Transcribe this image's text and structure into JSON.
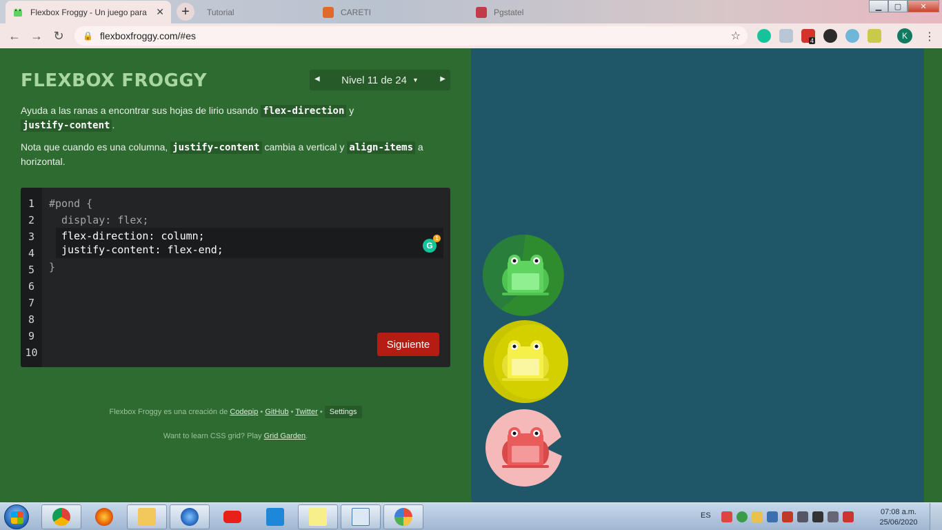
{
  "browser": {
    "tabs": [
      {
        "title": "Flexbox Froggy - Un juego para a",
        "active": true
      },
      {
        "title": "Tutorial",
        "active": false
      },
      {
        "title": "CARETI",
        "active": false
      },
      {
        "title": "Pgstatel",
        "active": false
      }
    ],
    "url": "flexboxfroggy.com/#es",
    "badge_count": "4",
    "profile_initial": "K"
  },
  "header": {
    "logo": "FLEXBOX FROGGY",
    "level_label": "Nivel 11 de 24",
    "prev_icon": "◀",
    "next_icon": "▶",
    "caret_icon": "▼"
  },
  "instructions": {
    "p1_before": "Ayuda a las ranas a encontrar sus hojas de lirio usando ",
    "p1_code1": "flex-direction",
    "p1_between": " y",
    "p1_code2": "justify-content",
    "p1_after": ".",
    "p2_before": "Nota que cuando es una columna, ",
    "p2_code1": "justify-content",
    "p2_between": " cambia a vertical y ",
    "p2_code2": "align-items",
    "p2_after": " a",
    "p2_line2": "horizontal."
  },
  "editor": {
    "line_numbers": [
      "1",
      "2",
      "3",
      "4",
      "5",
      "6",
      "7",
      "8",
      "9",
      "10"
    ],
    "line1": "#pond {",
    "line2": "  display: flex;",
    "input_line1": "flex-direction: column;",
    "input_line2": "justify-content: flex-end;",
    "line5": "}",
    "grammarly_letter": "G",
    "grammarly_count": "1",
    "next_label": "Siguiente"
  },
  "footer": {
    "credit_prefix": "Flexbox Froggy es una creación de",
    "link_codepip": "Codepip",
    "link_github": "GitHub",
    "link_twitter": "Twitter",
    "separator": "•",
    "settings_label": "Settings",
    "grid_prefix": "Want to learn CSS grid? Play",
    "link_grid_garden": "Grid Garden",
    "grid_suffix": "."
  },
  "pond": {
    "items": [
      {
        "color": "green",
        "lily": "#2e8b2e",
        "frog": "#5fd35f"
      },
      {
        "color": "yellow",
        "lily": "#c8c400",
        "frog": "#f5f04a"
      },
      {
        "color": "red",
        "lily": "#f6b9b9",
        "frog": "#e85c5c"
      }
    ]
  },
  "taskbar": {
    "language": "ES",
    "time": "07:08 a.m.",
    "date": "25/06/2020"
  }
}
